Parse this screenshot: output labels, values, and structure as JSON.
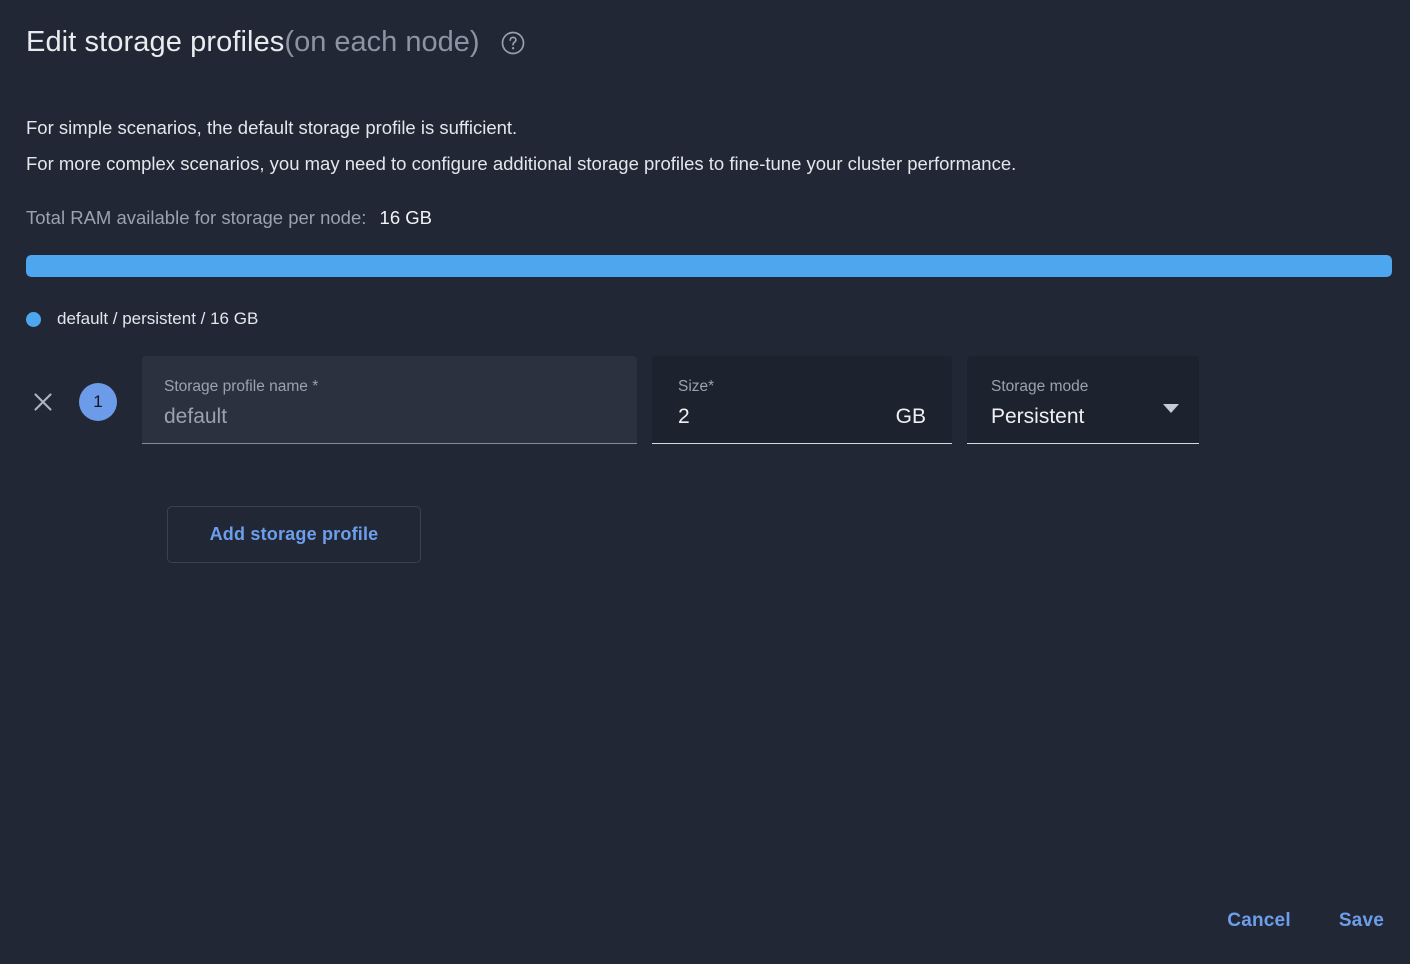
{
  "dialog": {
    "title_main": "Edit storage profiles",
    "title_sub": "(on each node)",
    "help_icon": "help-circle-icon"
  },
  "description": {
    "line1": "For simple scenarios, the default storage profile is sufficient.",
    "line2": "For more complex scenarios, you may need to configure additional storage profiles to fine-tune your cluster performance."
  },
  "ram": {
    "label": "Total RAM available for storage per node:",
    "value": "16 GB"
  },
  "usage_bar": {
    "fill_percent": 100,
    "color": "#4da6ee"
  },
  "legend": [
    {
      "label": "default / persistent / 16 GB",
      "color": "#4da6ee"
    }
  ],
  "profiles": [
    {
      "index": "1",
      "remove_icon": "close-x-icon",
      "name_field": {
        "label": "Storage profile name *",
        "value": "default"
      },
      "size_field": {
        "label": "Size*",
        "value": "2",
        "unit": "GB"
      },
      "mode_field": {
        "label": "Storage mode",
        "value": "Persistent",
        "caret_icon": "chevron-down-icon",
        "options": [
          "Persistent"
        ]
      }
    }
  ],
  "actions": {
    "add_label": "Add storage profile",
    "cancel_label": "Cancel",
    "save_label": "Save"
  }
}
